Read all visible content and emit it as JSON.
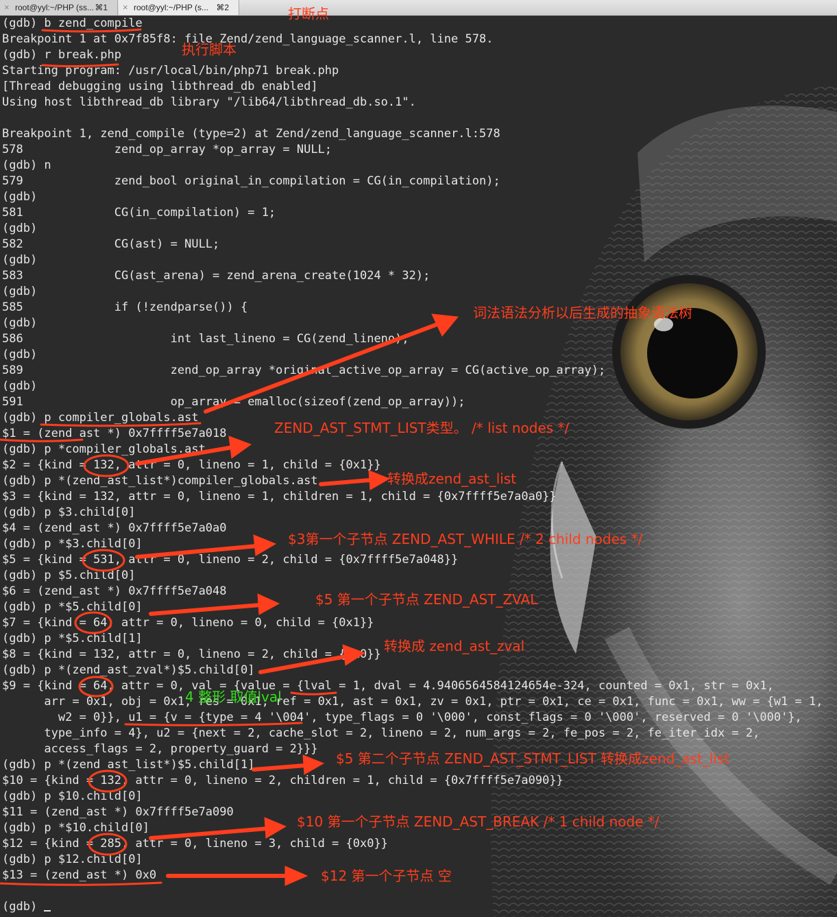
{
  "tabs": [
    {
      "title": "root@yyl:~/PHP (ss...",
      "shortcut": "⌘1"
    },
    {
      "title": "root@yyl:~/PHP (s...",
      "shortcut": "⌘2"
    }
  ],
  "terminal": {
    "lines": [
      "(gdb) b zend_compile",
      "Breakpoint 1 at 0x7f85f8: file Zend/zend_language_scanner.l, line 578.",
      "(gdb) r break.php",
      "Starting program: /usr/local/bin/php71 break.php",
      "[Thread debugging using libthread_db enabled]",
      "Using host libthread_db library \"/lib64/libthread_db.so.1\".",
      "",
      "Breakpoint 1, zend_compile (type=2) at Zend/zend_language_scanner.l:578",
      "578             zend_op_array *op_array = NULL;",
      "(gdb) n",
      "579             zend_bool original_in_compilation = CG(in_compilation);",
      "(gdb)",
      "581             CG(in_compilation) = 1;",
      "(gdb)",
      "582             CG(ast) = NULL;",
      "(gdb)",
      "583             CG(ast_arena) = zend_arena_create(1024 * 32);",
      "(gdb)",
      "585             if (!zendparse()) {",
      "(gdb)",
      "586                     int last_lineno = CG(zend_lineno);",
      "(gdb)",
      "589                     zend_op_array *original_active_op_array = CG(active_op_array);",
      "(gdb)",
      "591                     op_array = emalloc(sizeof(zend_op_array));",
      "(gdb) p compiler_globals.ast",
      "$1 = (zend_ast *) 0x7ffff5e7a018",
      "(gdb) p *compiler_globals.ast",
      "$2 = {kind = 132, attr = 0, lineno = 1, child = {0x1}}",
      "(gdb) p *(zend_ast_list*)compiler_globals.ast",
      "$3 = {kind = 132, attr = 0, lineno = 1, children = 1, child = {0x7ffff5e7a0a0}}",
      "(gdb) p $3.child[0]",
      "$4 = (zend_ast *) 0x7ffff5e7a0a0",
      "(gdb) p *$3.child[0]",
      "$5 = {kind = 531, attr = 0, lineno = 2, child = {0x7ffff5e7a048}}",
      "(gdb) p $5.child[0]",
      "$6 = (zend_ast *) 0x7ffff5e7a048",
      "(gdb) p *$5.child[0]",
      "$7 = {kind = 64, attr = 0, lineno = 0, child = {0x1}}",
      "(gdb) p *$5.child[1]",
      "$8 = {kind = 132, attr = 0, lineno = 2, child = {0x0}}",
      "(gdb) p *(zend_ast_zval*)$5.child[0]",
      "$9 = {kind = 64, attr = 0, val = {value = {lval = 1, dval = 4.9406564584124654e-324, counted = 0x1, str = 0x1,",
      "      arr = 0x1, obj = 0x1, res = 0x1, ref = 0x1, ast = 0x1, zv = 0x1, ptr = 0x1, ce = 0x1, func = 0x1, ww = {w1 = 1,",
      "        w2 = 0}}, u1 = {v = {type = 4 '\\004', type_flags = 0 '\\000', const_flags = 0 '\\000', reserved = 0 '\\000'},",
      "      type_info = 4}, u2 = {next = 2, cache_slot = 2, lineno = 2, num_args = 2, fe_pos = 2, fe_iter_idx = 2,",
      "      access_flags = 2, property_guard = 2}}}",
      "(gdb) p *(zend_ast_list*)$5.child[1]",
      "$10 = {kind = 132, attr = 0, lineno = 2, children = 1, child = {0x7ffff5e7a090}}",
      "(gdb) p $10.child[0]",
      "$11 = (zend_ast *) 0x7ffff5e7a090",
      "(gdb) p *$10.child[0]",
      "$12 = {kind = 285, attr = 0, lineno = 3, child = {0x0}}",
      "(gdb) p $12.child[0]",
      "$13 = (zend_ast *) 0x0"
    ],
    "prompt": "(gdb) "
  },
  "annotations": {
    "a1": "打断点",
    "a2": "执行脚本",
    "a3": "词法语法分析以后生成的抽象语法树",
    "a4": "ZEND_AST_STMT_LIST类型。 /*    list nodes   */",
    "a5": "转换成zend_ast_list",
    "a6": "$3第一个子节点  ZEND_AST_WHILE    /*    2 child  nodes    */",
    "a7": "$5 第一个子节点    ZEND_AST_ZVAL",
    "a8": "转换成 zend_ast_zval",
    "a9": "4 整形  取值lval",
    "a10": "$5 第二个子节点  ZEND_AST_STMT_LIST   转换成zend_ast_list",
    "a11": "$10 第一个子节点  ZEND_AST_BREAK    /*   1  child  node  */",
    "a12": "$12 第一个子节点  空"
  },
  "colors": {
    "annotation": "#ff3e1d",
    "annotation_green": "#33e01a",
    "terminal_bg": "#2b2b2b",
    "terminal_text": "#e6e6e6"
  },
  "icons": [
    "close-icon",
    "owl-wallpaper",
    "arrow"
  ]
}
